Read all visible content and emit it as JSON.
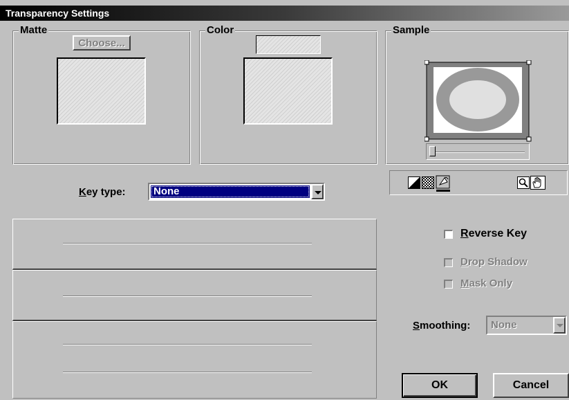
{
  "window": {
    "title": "Transparency Settings"
  },
  "matte": {
    "label": "Matte",
    "choose_button": "Choose..."
  },
  "color": {
    "label": "Color"
  },
  "sample": {
    "label": "Sample",
    "slider_value": 0,
    "colors": {
      "ring": "#999999",
      "fill": "#e0e0e0",
      "frame": "#808080"
    }
  },
  "toolbar": {
    "icons": [
      "contrast-icon",
      "checkerboard-icon",
      "paint-bucket-icon",
      "zoom-icon",
      "hand-icon"
    ]
  },
  "key_type": {
    "label_underlined": "K",
    "label_rest": "ey type:",
    "value": "None"
  },
  "options": {
    "reverse_key": {
      "underlined": "R",
      "rest": "everse Key",
      "checked": false,
      "enabled": true
    },
    "drop_shadow": {
      "underlined": "D",
      "rest": "rop Shadow",
      "checked": false,
      "enabled": false
    },
    "mask_only": {
      "underlined": "M",
      "rest": "ask Only",
      "checked": false,
      "enabled": false
    }
  },
  "smoothing": {
    "label_underlined": "S",
    "label_rest": "moothing:",
    "value": "None",
    "enabled": false
  },
  "buttons": {
    "ok": "OK",
    "cancel": "Cancel"
  }
}
